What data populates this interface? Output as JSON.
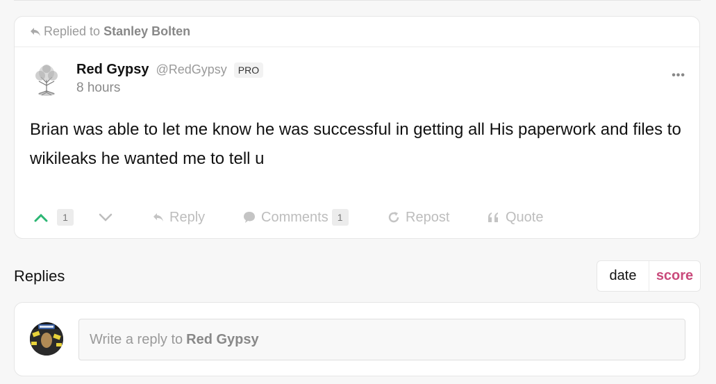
{
  "post": {
    "replied_prefix": "Replied to",
    "replied_to": "Stanley Bolten",
    "author_name": "Red Gypsy",
    "author_handle": "@RedGypsy",
    "badge": "PRO",
    "time": "8 hours",
    "more": "•••",
    "text": "Brian was able to let me know he was successful in getting all His paperwork and files to wikileaks he wanted me to tell u",
    "actions": {
      "upvote_count": "1",
      "reply_label": "Reply",
      "comments_label": "Comments",
      "comments_count": "1",
      "repost_label": "Repost",
      "quote_label": "Quote"
    }
  },
  "replies": {
    "title": "Replies",
    "sort_options": [
      "date",
      "score"
    ],
    "active_sort": "score"
  },
  "reply_box": {
    "placeholder_prefix": "Write a reply to",
    "placeholder_name": "Red Gypsy"
  },
  "colors": {
    "upvote": "#2bb673",
    "active_sort": "#c94a7b",
    "muted": "#bdbdbd"
  },
  "icons": [
    "reply-arrow-icon",
    "avatar-tree",
    "more-dots-icon",
    "upvote-chevron-icon",
    "downvote-chevron-icon",
    "reply-icon",
    "comment-bubble-icon",
    "repost-icon",
    "quote-icon"
  ]
}
